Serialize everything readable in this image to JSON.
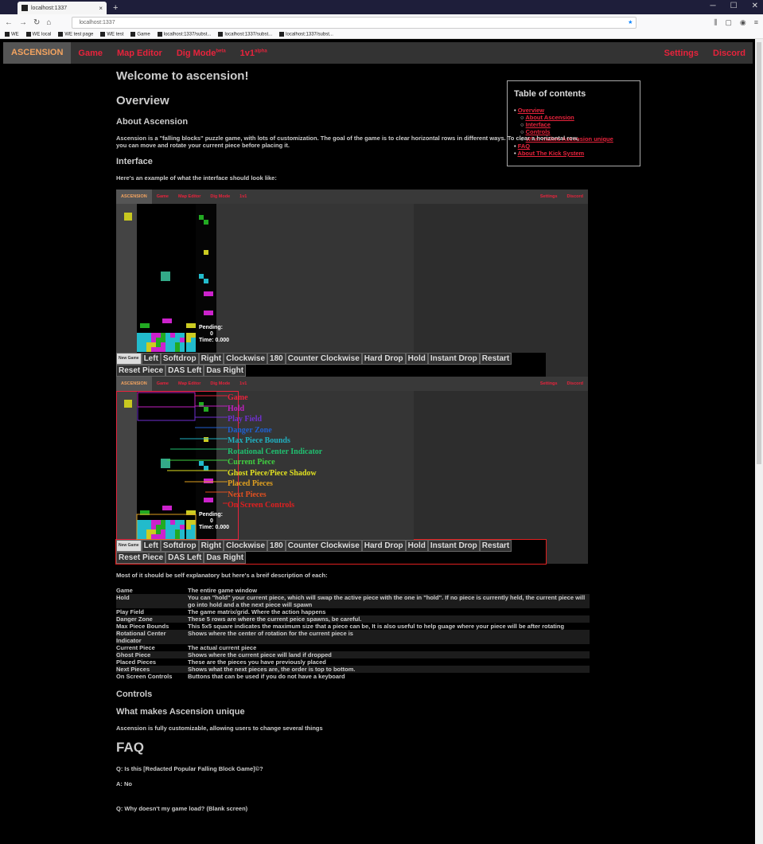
{
  "browser": {
    "tab_title": "localhost:1337",
    "url": "localhost:1337",
    "bookmarks": [
      "WE",
      "WE local",
      "WE test page",
      "WE test",
      "Game",
      "localhost:1337/subst...",
      "localhost:1337/subst...",
      "localhost:1337/subst..."
    ]
  },
  "nav": {
    "brand": "ASCENSION",
    "game": "Game",
    "map_editor": "Map Editor",
    "dig_mode": "Dig Mode",
    "dig_sup": "beta",
    "onevone": "1v1",
    "onevone_sup": "alpha",
    "settings": "Settings",
    "discord": "Discord"
  },
  "content": {
    "welcome": "Welcome to ascension!",
    "overview": "Overview",
    "about_h": "About Ascension",
    "about_p": "Ascension is a \"falling blocks\" puzzle game, with lots of customization. The goal of the game is to clear horizontal rows in different ways. To clear a horizontal row, you can move and rotate your current piece before placing it.",
    "interface_h": "Interface",
    "interface_p": "Here's an example of what the interface should look like:",
    "explain_p": "Most of it should be self explanatory but here's a breif description of each:",
    "controls_h": "Controls",
    "unique_h": "What makes Ascension unique",
    "unique_p": "Ascension is fully customizable, allowing users to change several things",
    "faq_h": "FAQ",
    "faq_q1": "Q: Is this [Redacted Popular Falling Block Game]©?",
    "faq_a1": "A: No",
    "faq_q2": "Q: Why doesn't my game load? (Blank screen)"
  },
  "toc": {
    "title": "Table of contents",
    "items": [
      "Overview",
      "About Ascension",
      "Interface",
      "Controls",
      "What makes Ascension unique",
      "FAQ",
      "About The Kick System"
    ]
  },
  "game": {
    "pending_label": "Pending:",
    "pending_value": "0",
    "time": "Time: 0.000",
    "new_game": "New Game",
    "controls": [
      "Left",
      "Softdrop",
      "Right",
      "Clockwise",
      "180",
      "Counter Clockwise",
      "Hard Drop",
      "Hold",
      "Instant Drop",
      "Restart",
      "Reset Piece",
      "DAS Left",
      "Das Right"
    ]
  },
  "annotations": [
    {
      "label": "Game",
      "color": "#e8233c"
    },
    {
      "label": "Hold",
      "color": "#c020c0"
    },
    {
      "label": "Play Field",
      "color": "#7030d0"
    },
    {
      "label": "Danger Zone",
      "color": "#2060d0"
    },
    {
      "label": "Max Piece Bounds",
      "color": "#20b0c0"
    },
    {
      "label": "Rotational Center Indicator",
      "color": "#20c070"
    },
    {
      "label": "Current Piece",
      "color": "#40d040"
    },
    {
      "label": "Ghost Piece/Piece Shadow",
      "color": "#e0e020"
    },
    {
      "label": "Placed Pieces",
      "color": "#e0a020"
    },
    {
      "label": "Next Pieces",
      "color": "#e05020"
    },
    {
      "label": "On Screen Controls",
      "color": "#e02020"
    }
  ],
  "descriptions": [
    {
      "k": "Game",
      "v": "The entire game window"
    },
    {
      "k": "Hold",
      "v": "You can \"hold\" your current piece, which will swap the active piece with the one in \"hold\". If no piece is currently held, the current piece will go into hold and a the next piece will spawn"
    },
    {
      "k": "Play Field",
      "v": "The game matrix/grid. Where the action happens"
    },
    {
      "k": "Danger Zone",
      "v": "These 5 rows are where the current peice spawns, be careful."
    },
    {
      "k": "Max Piece Bounds",
      "v": "This 5x5 square indicates the maximum size that a piece can be, It is also useful to help guage where your piece will be after rotating"
    },
    {
      "k": "Rotational Center Indicator",
      "v": "Shows where the center of rotation for the current piece is"
    },
    {
      "k": "Current Piece",
      "v": "The actual current piece"
    },
    {
      "k": "Ghost Piece",
      "v": "Shows where the current piece will land if dropped"
    },
    {
      "k": "Placed Pieces",
      "v": "These are the pieces you have previously placed"
    },
    {
      "k": "Next Pieces",
      "v": "Shows what the next pieces are, the order is top to bottom."
    },
    {
      "k": "On Screen Controls",
      "v": "Buttons that can be used if you do not have a keyboard"
    }
  ],
  "colors": {
    "accent": "#e8233c",
    "brand": "#f4a460",
    "bg": "#000000"
  }
}
